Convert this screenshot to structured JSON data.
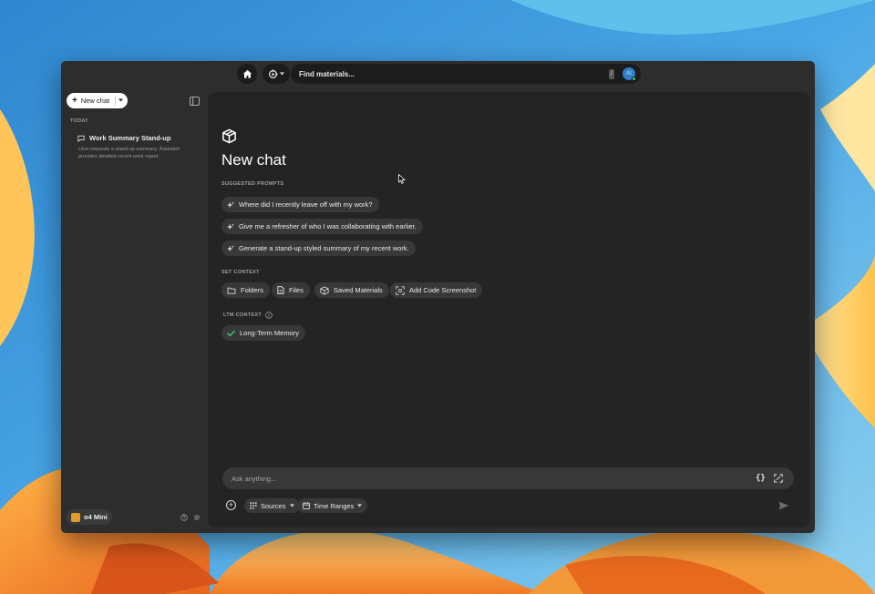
{
  "topbar": {
    "search_placeholder": "Find materials...",
    "shortcut_key": "/",
    "avatar_initials": "AI"
  },
  "sidebar": {
    "new_chat_label": "New chat",
    "today_label": "TODAY",
    "history": [
      {
        "title": "Work Summary Stand-up",
        "description": "User requests a stand-up summary; Assistant provides detailed recent work report."
      }
    ],
    "model_label": "o4 Mini"
  },
  "main": {
    "title": "New chat",
    "suggested_prompts_label": "SUGGESTED PROMPTS",
    "suggested_prompts": [
      "Where did I recently leave off with my work?",
      "Give me a refresher of who I was collaborating with earlier.",
      "Generate a stand-up styled summary of my recent work."
    ],
    "set_context_label": "SET CONTEXT",
    "context_buttons": [
      "Folders",
      "Files",
      "Saved Materials",
      "Add Code Screenshot"
    ],
    "ltm_context_label": "LTM CONTEXT",
    "ltm_chip": "Long-Term Memory",
    "composer_placeholder": "Ask anything...",
    "sources_label": "Sources",
    "time_ranges_label": "Time Ranges"
  },
  "colors": {
    "window_bg": "#2d2d2d",
    "panel_bg": "#242424",
    "chip_bg": "#383838",
    "check_green": "#4cd07d",
    "model_icon": "#e59a2a",
    "avatar_blue": "#2f7fc9"
  },
  "icons": [
    "home-icon",
    "agent-icon",
    "sidebar-toggle-icon",
    "chat-bubble-icon",
    "sparkle-icon",
    "folder-icon",
    "file-icon",
    "cube-icon",
    "screenshot-icon",
    "info-icon",
    "check-icon",
    "help-icon",
    "gear-icon",
    "braces-icon",
    "plus-circle-icon",
    "grid-icon",
    "calendar-icon",
    "send-icon"
  ]
}
